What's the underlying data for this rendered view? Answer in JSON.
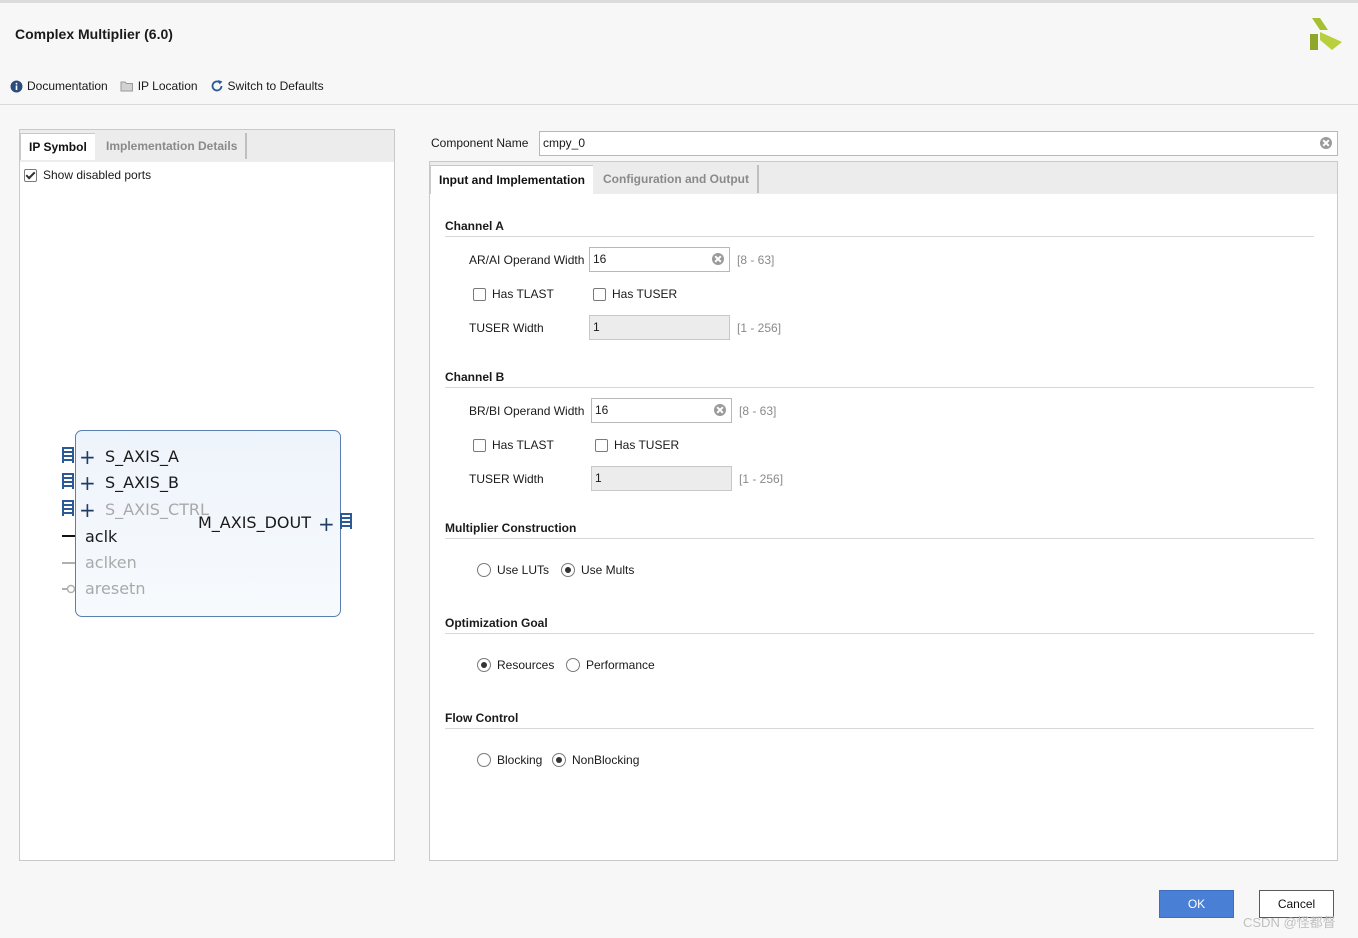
{
  "window": {
    "title": "Complex Multiplier (6.0)"
  },
  "toolbar": {
    "documentation": "Documentation",
    "ip_location": "IP Location",
    "switch_defaults": "Switch to Defaults"
  },
  "left_panel": {
    "tabs": [
      "IP Symbol",
      "Implementation Details"
    ],
    "show_disabled_ports": "Show disabled ports",
    "symbol": {
      "inputs": [
        "S_AXIS_A",
        "S_AXIS_B",
        "S_AXIS_CTRL"
      ],
      "clk": "aclk",
      "clken": "aclken",
      "resetn": "aresetn",
      "output": "M_AXIS_DOUT"
    }
  },
  "component": {
    "label": "Component Name",
    "value": "cmpy_0"
  },
  "right_panel": {
    "tabs": [
      "Input and Implementation",
      "Configuration and Output"
    ],
    "channel_a": {
      "title": "Channel A",
      "width_label": "AR/AI Operand Width",
      "width_value": "16",
      "width_range": "[8 - 63]",
      "has_tlast": "Has TLAST",
      "has_tuser": "Has TUSER",
      "tuser_label": "TUSER Width",
      "tuser_value": "1",
      "tuser_range": "[1 - 256]"
    },
    "channel_b": {
      "title": "Channel B",
      "width_label": "BR/BI Operand Width",
      "width_value": "16",
      "width_range": "[8 - 63]",
      "has_tlast": "Has TLAST",
      "has_tuser": "Has TUSER",
      "tuser_label": "TUSER Width",
      "tuser_value": "1",
      "tuser_range": "[1 - 256]"
    },
    "multiplier": {
      "title": "Multiplier Construction",
      "opt1": "Use LUTs",
      "opt2": "Use Mults"
    },
    "optimization": {
      "title": "Optimization Goal",
      "opt1": "Resources",
      "opt2": "Performance"
    },
    "flow": {
      "title": "Flow Control",
      "opt1": "Blocking",
      "opt2": "NonBlocking"
    }
  },
  "buttons": {
    "ok": "OK",
    "cancel": "Cancel"
  },
  "watermark": "CSDN @怪都督",
  "colors": {
    "accent": "#4a7fd6",
    "symbol_border": "#5b7fb0",
    "logo": "#a7c02f"
  }
}
